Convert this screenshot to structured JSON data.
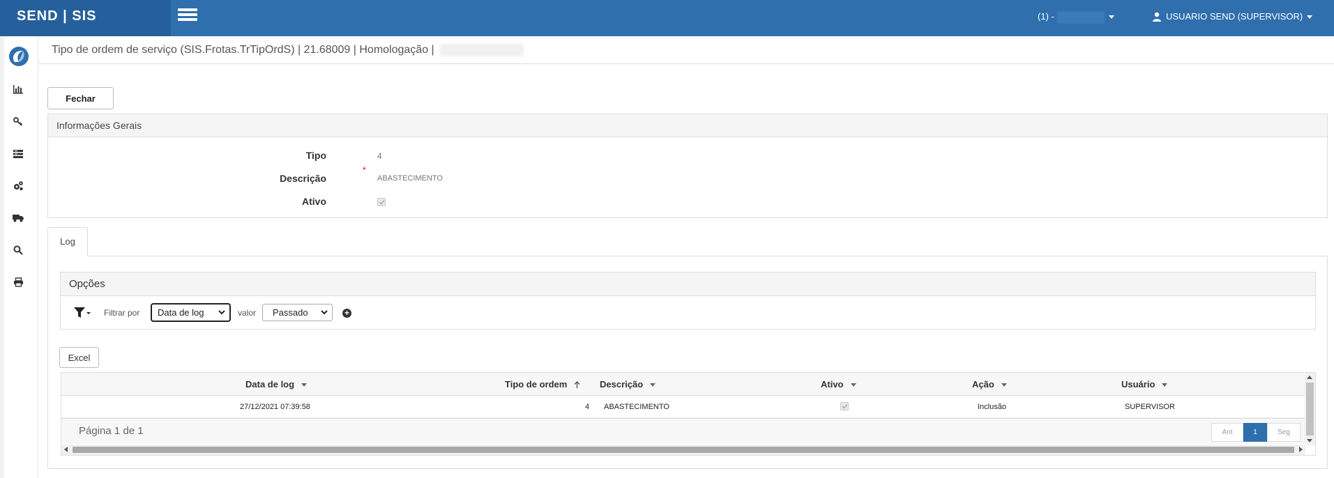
{
  "app": {
    "brand": "SEND | SIS",
    "company_selector": "(1) -",
    "user_label": "USUARIO SEND (SUPERVISOR)"
  },
  "sidebar": {
    "items": [
      {
        "icon": "app-logo-icon"
      },
      {
        "icon": "bar-chart-icon"
      },
      {
        "icon": "key-icon"
      },
      {
        "icon": "list-icon"
      },
      {
        "icon": "gears-icon"
      },
      {
        "icon": "truck-icon"
      },
      {
        "icon": "search-icon"
      },
      {
        "icon": "print-icon"
      }
    ]
  },
  "page": {
    "title": "Tipo de ordem de serviço (SIS.Frotas.TrTipOrdS) | 21.68009 | Homologação |"
  },
  "toolbar": {
    "close_label": "Fechar"
  },
  "general": {
    "heading": "Informações Gerais",
    "fields": {
      "tipo_label": "Tipo",
      "tipo_value": "4",
      "descricao_label": "Descrição",
      "descricao_value": "ABASTECIMENTO",
      "required_mark": "*",
      "ativo_label": "Ativo",
      "ativo_checked": true
    }
  },
  "tabs": [
    {
      "label": "Log",
      "active": true
    }
  ],
  "options": {
    "heading": "Opções",
    "filter_label": "Filtrar por",
    "filter_value": "Data de log",
    "value_label": "valor",
    "value_value": "Passado"
  },
  "grid": {
    "excel_label": "Excel",
    "columns": [
      "Data de log",
      "Tipo de ordem",
      "Descrição",
      "Ativo",
      "Ação",
      "Usuário"
    ],
    "rows": [
      {
        "data_log": "27/12/2021 07:39:58",
        "tipo_ordem": "4",
        "descricao": "ABASTECIMENTO",
        "ativo": true,
        "acao": "Inclusão",
        "usuario": "SUPERVISOR"
      }
    ],
    "page_info": "Página 1 de 1",
    "pager": {
      "prev": "Ant",
      "current": "1",
      "next": "Seg"
    }
  },
  "colors": {
    "topbar": "#2f6fad",
    "brand_bg": "#25609c",
    "accent": "#2f6fad"
  }
}
